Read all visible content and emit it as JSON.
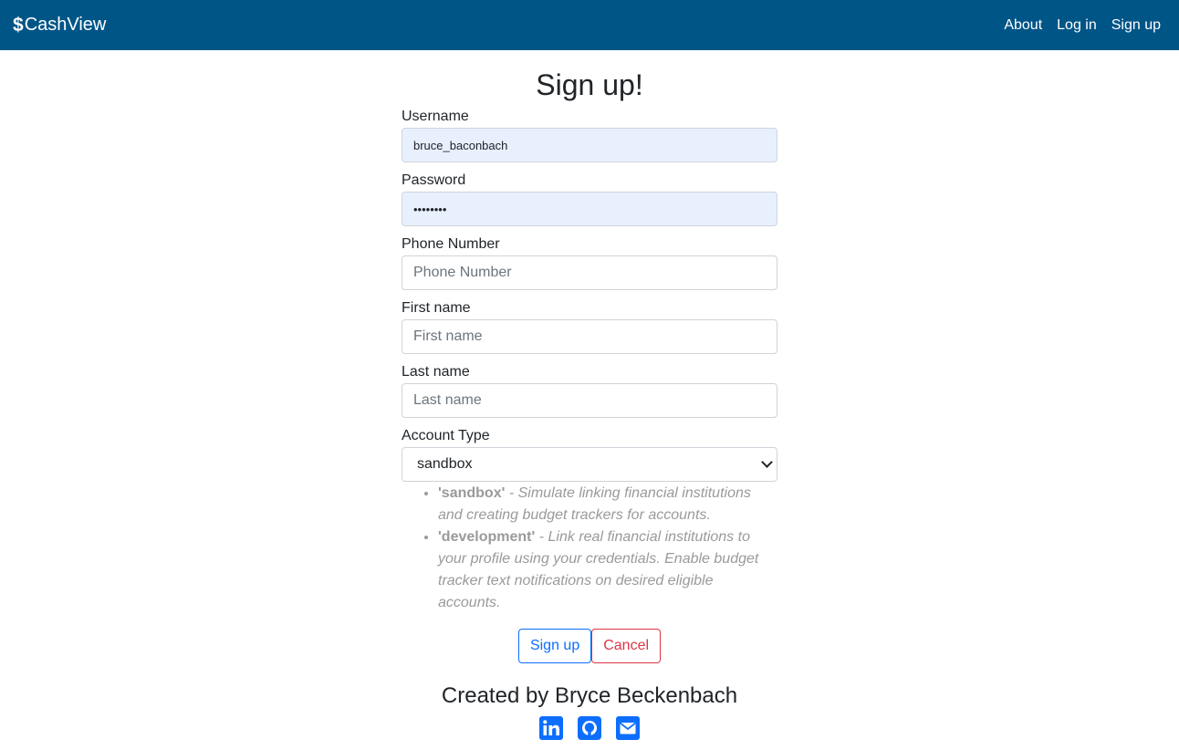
{
  "nav": {
    "brand_symbol": "$",
    "brand": "CashView",
    "links": [
      "About",
      "Log in",
      "Sign up"
    ]
  },
  "form": {
    "title": "Sign up!",
    "username": {
      "label": "Username",
      "value": "bruce_baconbach"
    },
    "password": {
      "label": "Password",
      "value": "••••••••"
    },
    "phone": {
      "label": "Phone Number",
      "placeholder": "Phone Number"
    },
    "first_name": {
      "label": "First name",
      "placeholder": "First name"
    },
    "last_name": {
      "label": "Last name",
      "placeholder": "Last name"
    },
    "account_type": {
      "label": "Account Type",
      "selected": "sandbox",
      "help": [
        {
          "key": "'sandbox'",
          "text": " - Simulate linking financial institutions and creating budget trackers for accounts."
        },
        {
          "key": "'development'",
          "text": " - Link real financial institutions to your profile using your credentials. Enable budget tracker text notifications on desired eligible accounts."
        }
      ]
    },
    "submit_label": "Sign up",
    "cancel_label": "Cancel"
  },
  "footer": {
    "title": "Created by Bryce Beckenbach",
    "icons": [
      "linkedin-icon",
      "github-icon",
      "envelope-icon"
    ]
  },
  "colors": {
    "navbar": "#005587",
    "primary": "#0d6efd",
    "danger": "#dc3545",
    "autofill": "#e8f0fe"
  }
}
